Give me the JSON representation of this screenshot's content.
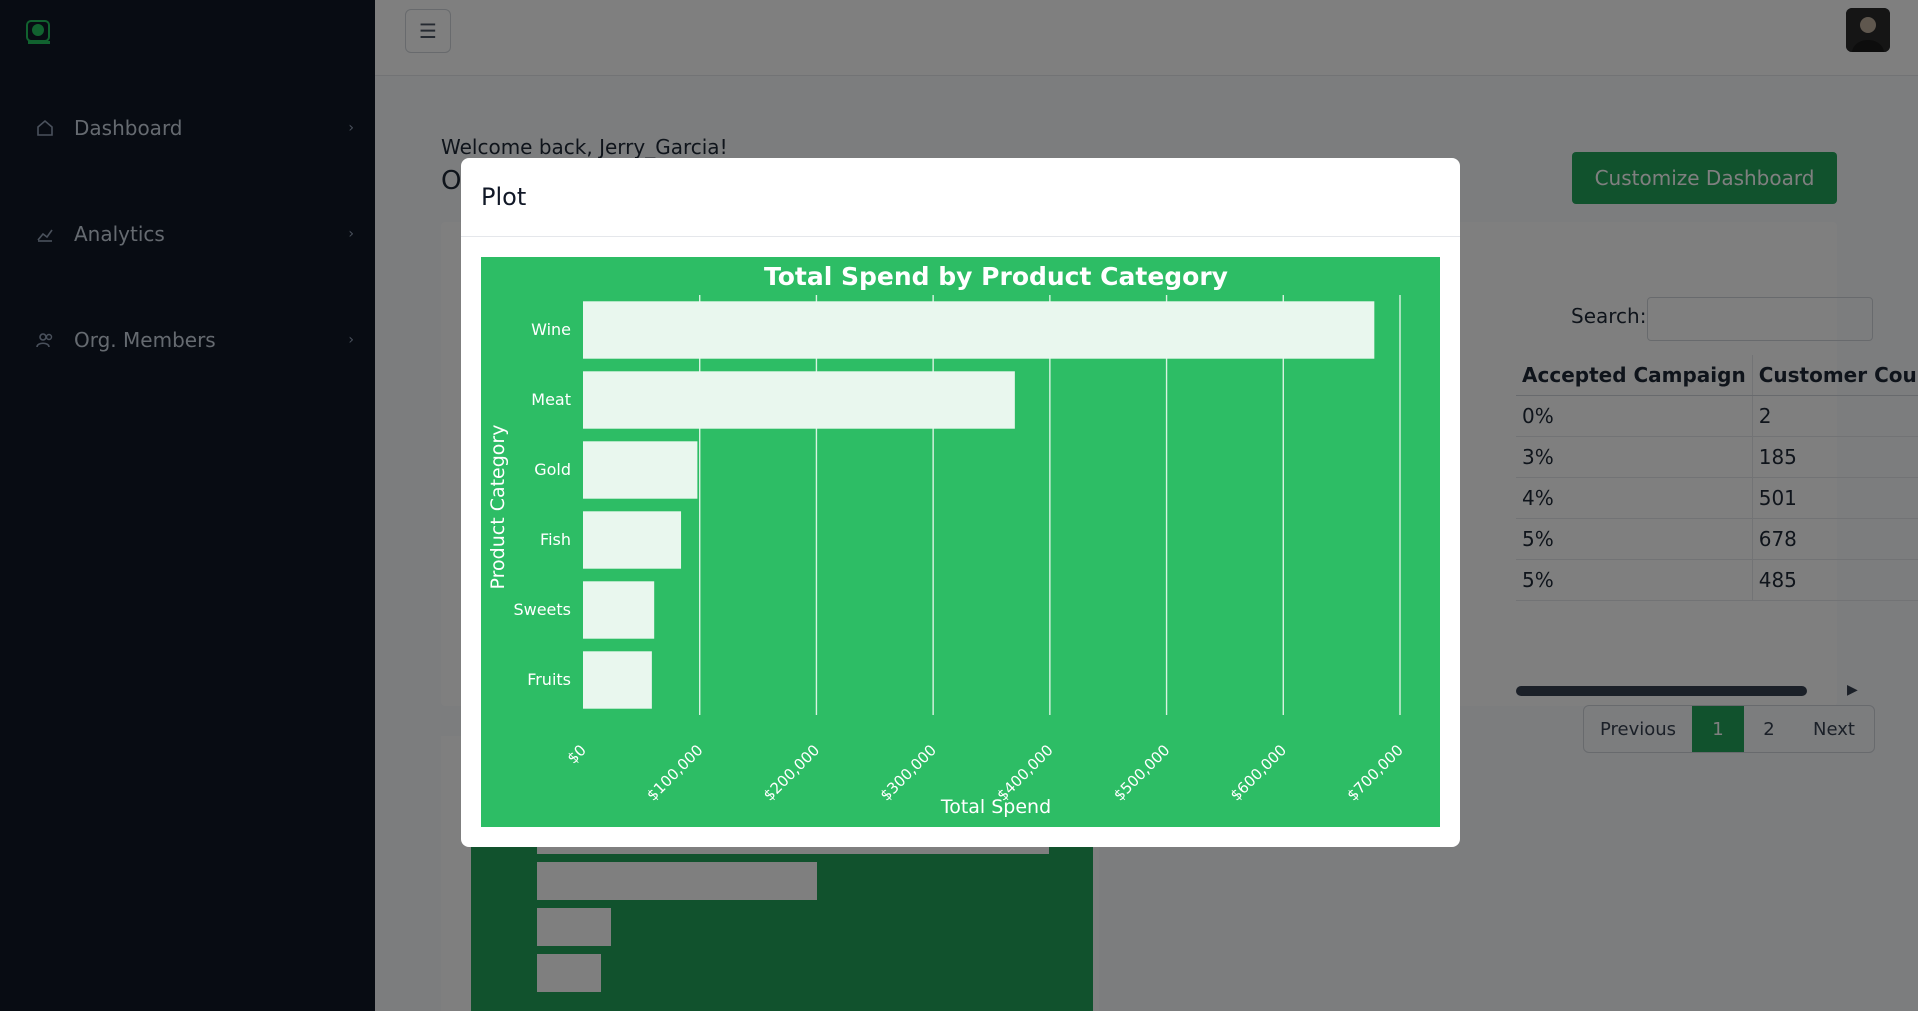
{
  "sidebar": {
    "items": [
      {
        "label": "Dashboard",
        "icon": "home-icon"
      },
      {
        "label": "Analytics",
        "icon": "chart-line-icon"
      },
      {
        "label": "Org. Members",
        "icon": "users-icon"
      }
    ]
  },
  "header": {
    "menu_icon": "hamburger-icon"
  },
  "main": {
    "welcome": "Welcome back, Jerry_Garcia!",
    "title_initial": "O",
    "customize_label": "Customize Dashboard",
    "search_label": "Search:",
    "table": {
      "headers": [
        "Accepted Campaign",
        "Customer Cour"
      ],
      "rows": [
        [
          "0%",
          "2"
        ],
        [
          "3%",
          "185"
        ],
        [
          "4%",
          "501"
        ],
        [
          "5%",
          "678"
        ],
        [
          "5%",
          "485"
        ]
      ]
    },
    "pagination": {
      "prev": "Previous",
      "pages": [
        "1",
        "2"
      ],
      "next": "Next",
      "active": "1"
    }
  },
  "modal": {
    "title": "Plot"
  },
  "colors": {
    "sidebar_bg": "#111827",
    "accent": "#22a55b",
    "chart_bg": "#2dbd65",
    "bar_fill": "#e9f7ee"
  },
  "chart_data": {
    "type": "bar",
    "orientation": "horizontal",
    "title": "Total Spend by Product Category",
    "xlabel": "Total Spend",
    "ylabel": "Product Category",
    "categories": [
      "Wine",
      "Meat",
      "Gold",
      "Fish",
      "Sweets",
      "Fruits"
    ],
    "values": [
      678000,
      370000,
      98000,
      84000,
      61000,
      59000
    ],
    "xlim": [
      0,
      700000
    ],
    "xticks": [
      "$0",
      "$100,000",
      "$200,000",
      "$300,000",
      "$400,000",
      "$500,000",
      "$600,000",
      "$700,000"
    ],
    "grid": true
  }
}
